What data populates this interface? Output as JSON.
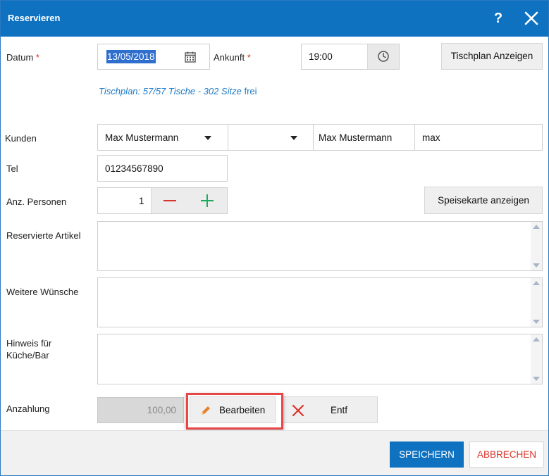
{
  "titlebar": {
    "title": "Reservieren",
    "help_icon": "?"
  },
  "form": {
    "datum_label": "Datum",
    "required_mark": "*",
    "datum_value": "13/05/2018",
    "ankunft_label": "Ankunft",
    "ankunft_value": "19:00",
    "tischplan_button": "Tischplan Anzeigen",
    "tischplan_info": "Tischplan: 57/57 Tische - 302 Sitze",
    "tischplan_frei": "frei",
    "kunden_label": "Kunden",
    "kunden_select_1": "Max Mustermann",
    "kunden_select_2": "",
    "kunden_name": "Max Mustermann",
    "kunden_short": "max",
    "tel_label": "Tel",
    "tel_value": "01234567890",
    "personen_label": "Anz. Personen",
    "personen_value": "1",
    "speisekarte_button": "Speisekarte anzeigen",
    "artikel_label": "Reservierte Artikel",
    "wuensche_label": "Weitere Wünsche",
    "hinweis_label_1": "Hinweis für",
    "hinweis_label_2": "Küche/Bar",
    "anzahlung_label": "Anzahlung",
    "anzahlung_value": "100,00",
    "bearbeiten_button": "Bearbeiten",
    "entf_button": "Entf"
  },
  "footer": {
    "save": "SPEICHERN",
    "cancel": "ABBRECHEN"
  },
  "colors": {
    "accent": "#0e72c1",
    "danger": "#d9342b",
    "plus": "#1aab5b",
    "highlight": "#e8474a"
  },
  "icons": {
    "calendar": "calendar-icon",
    "clock": "clock-icon",
    "minus": "minus-icon",
    "plus": "plus-icon",
    "pencil": "pencil-icon",
    "delete": "delete-x-icon",
    "close": "close-icon",
    "help": "help-icon"
  }
}
